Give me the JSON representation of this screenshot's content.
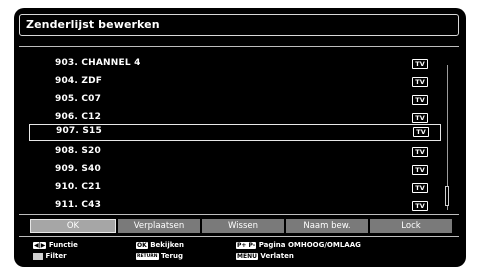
{
  "title": "Zenderlijst bewerken",
  "channels": [
    {
      "label": "903. CHANNEL 4",
      "type": "TV",
      "selected": false
    },
    {
      "label": "904. ZDF",
      "type": "TV",
      "selected": false
    },
    {
      "label": "905. C07",
      "type": "TV",
      "selected": false
    },
    {
      "label": "906. C12",
      "type": "TV",
      "selected": false
    },
    {
      "label": "907. S15",
      "type": "TV",
      "selected": true
    },
    {
      "label": "908. S20",
      "type": "TV",
      "selected": false
    },
    {
      "label": "909. S40",
      "type": "TV",
      "selected": false
    },
    {
      "label": "910. C21",
      "type": "TV",
      "selected": false
    },
    {
      "label": "911. C43",
      "type": "TV",
      "selected": false
    }
  ],
  "buttons": [
    {
      "label": "OK",
      "active": true
    },
    {
      "label": "Verplaatsen",
      "active": false
    },
    {
      "label": "Wissen",
      "active": false
    },
    {
      "label": "Naam bew.",
      "active": false
    },
    {
      "label": "Lock",
      "active": false
    }
  ],
  "help": {
    "function_key": "◀|▶",
    "function_label": "Functie",
    "filter_label": "Filter",
    "ok_key": "OK",
    "ok_label": "Bekijken",
    "return_key": "RETURN",
    "return_label": "Terug",
    "page_key": "P+ P-",
    "page_label": "Pagina OMHOOG/OMLAAG",
    "menu_key": "MENU",
    "menu_label": "Verlaten"
  },
  "colors": {
    "panel_bg": "#000000",
    "button_gray": "#7a7a7a",
    "button_active": "#a6a6a6",
    "text": "#ffffff"
  }
}
